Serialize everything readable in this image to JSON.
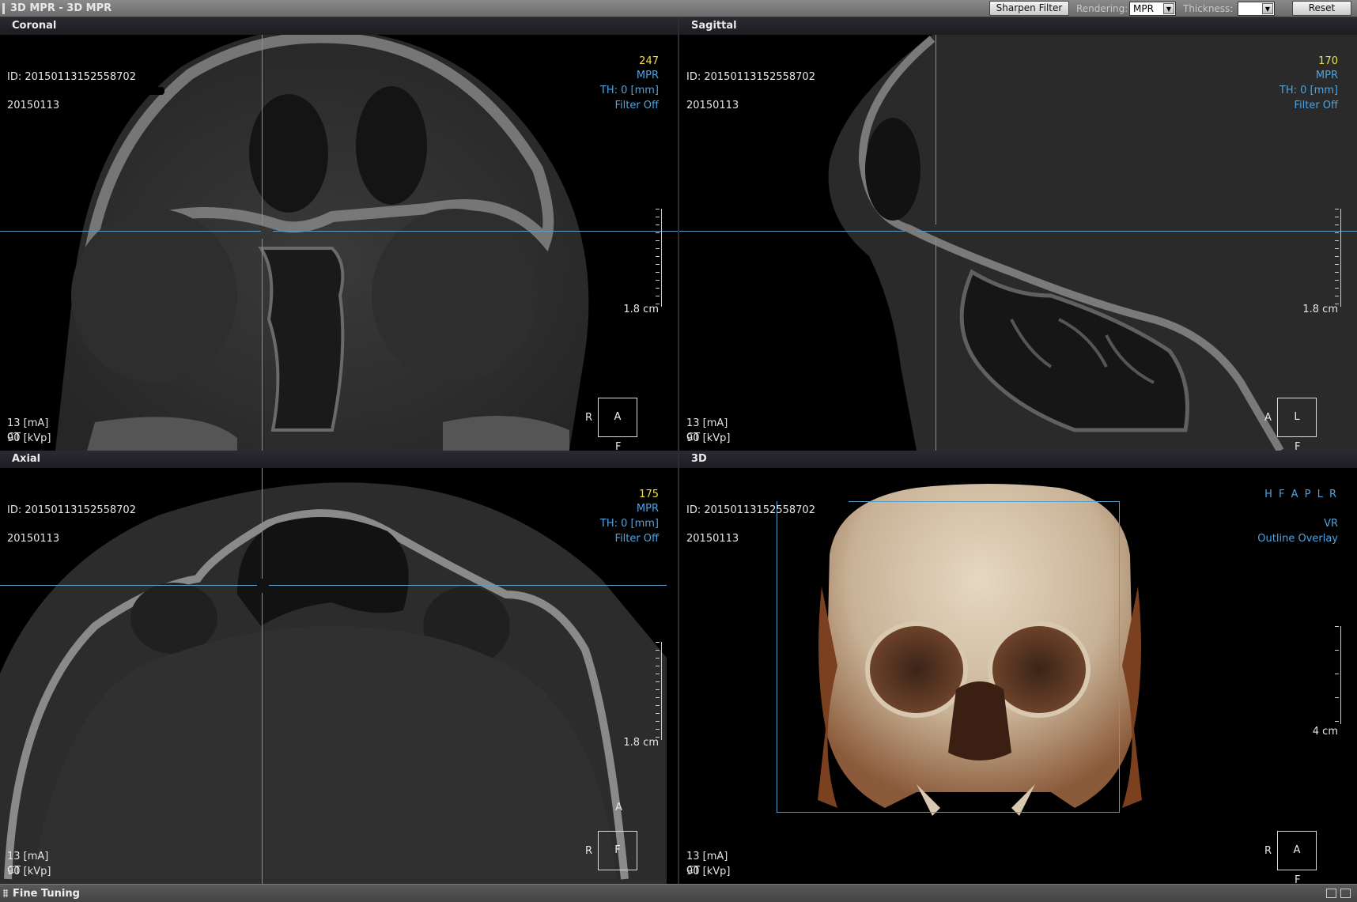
{
  "window": {
    "title": "3D MPR - 3D MPR"
  },
  "toolbar": {
    "sharpen_label": "Sharpen Filter",
    "rendering_label": "Rendering:",
    "rendering_value": "MPR",
    "thickness_label": "Thickness:",
    "thickness_value": "",
    "reset_label": "Reset"
  },
  "panes": {
    "coronal": {
      "title": "Coronal",
      "slice": "247",
      "id": "ID: 20150113152558702",
      "date": "20150113",
      "mode": "MPR",
      "th": "TH: 0 [mm]",
      "filter": "Filter Off",
      "scale": "1.8 cm",
      "ma": "13 [mA]",
      "kvp": "90 [kVp]",
      "modality": "CT",
      "orient_left": "R",
      "orient_center": "A",
      "orient_bottom": "F"
    },
    "sagittal": {
      "title": "Sagittal",
      "slice": "170",
      "id": "ID: 20150113152558702",
      "date": "20150113",
      "mode": "MPR",
      "th": "TH: 0 [mm]",
      "filter": "Filter Off",
      "scale": "1.8 cm",
      "ma": "13 [mA]",
      "kvp": "90 [kVp]",
      "modality": "CT",
      "orient_left": "A",
      "orient_center": "L",
      "orient_bottom": "F"
    },
    "axial": {
      "title": "Axial",
      "slice": "175",
      "id": "ID: 20150113152558702",
      "date": "20150113",
      "mode": "MPR",
      "th": "TH: 0 [mm]",
      "filter": "Filter Off",
      "scale": "1.8 cm",
      "ma": "13 [mA]",
      "kvp": "90 [kVp]",
      "modality": "CT",
      "orient_top": "A",
      "orient_left": "R",
      "orient_center": "F"
    },
    "three_d": {
      "title": "3D",
      "id": "ID: 20150113152558702",
      "date": "20150113",
      "orient_row": "H F A P L R",
      "mode": "VR",
      "overlay": "Outline Overlay",
      "scale": "4 cm",
      "ma": "13 [mA]",
      "kvp": "90 [kVp]",
      "modality": "CT",
      "orient_left": "R",
      "orient_center": "A",
      "orient_bottom": "F"
    }
  },
  "bottom_panel": {
    "title": "Fine Tuning"
  },
  "colors": {
    "crosshair": "#5a9cc8",
    "overlay_blue": "#4fa3e0",
    "slice_yellow": "#f0e040"
  }
}
